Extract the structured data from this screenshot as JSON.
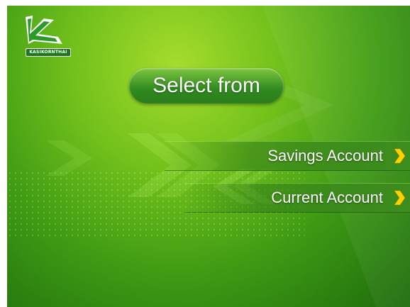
{
  "brand": {
    "name": "KASIKORNTHAI",
    "logo_icon": "k-bank-logo-icon",
    "colors": {
      "primary": "#2f8a1f",
      "accent": "#ffd200",
      "light": "#a6dc2e"
    }
  },
  "prompt": {
    "title": "Select from"
  },
  "options": [
    {
      "label": "Savings Account",
      "icon": "chevron-right-icon"
    },
    {
      "label": "Current Account",
      "icon": "chevron-right-icon"
    }
  ]
}
